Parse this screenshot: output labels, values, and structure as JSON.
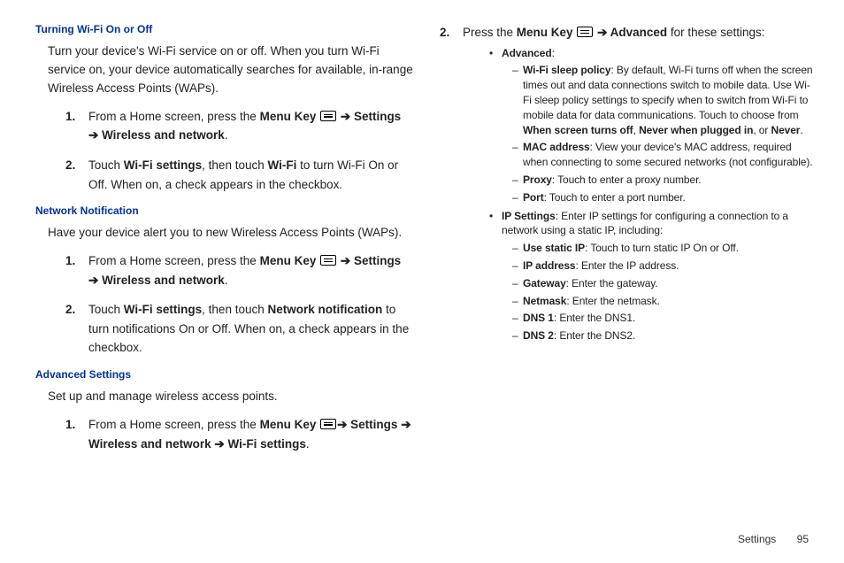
{
  "left": {
    "section1": {
      "heading": "Turning Wi-Fi On or Off",
      "intro": "Turn your device's Wi-Fi service on or off. When you turn Wi-Fi service on, your device automatically searches for available, in-range Wireless Access Points (WAPs).",
      "step1_a": "From a Home screen, press the ",
      "step1_menukey": "Menu Key",
      "step1_b": " ",
      "step1_arrow1": " ➔ ",
      "step1_settings": "Settings",
      "step1_arrow2": " ➔ ",
      "step1_wireless": "Wireless and network",
      "step1_end": ".",
      "step2_a": "Touch ",
      "step2_wifisettings": "Wi-Fi settings",
      "step2_b": ", then touch ",
      "step2_wifi": "Wi-Fi",
      "step2_c": " to turn Wi-Fi On or Off. When on, a check appears in the checkbox."
    },
    "section2": {
      "heading": "Network Notification",
      "intro": "Have your device alert you to new Wireless Access Points (WAPs).",
      "step1_a": "From a Home screen, press the ",
      "step1_menukey": "Menu Key",
      "step1_arrow1": " ➔ ",
      "step1_settings": "Settings",
      "step1_arrow2": " ➔ ",
      "step1_wireless": "Wireless and network",
      "step1_end": ".",
      "step2_a": "Touch ",
      "step2_wifisettings": "Wi-Fi settings",
      "step2_b": ", then touch ",
      "step2_netnotif": "Network notification",
      "step2_c": " to turn notifications On or Off. When on, a check appears in the checkbox."
    },
    "section3": {
      "heading": "Advanced Settings",
      "intro": "Set up and manage wireless access points.",
      "step1_a": "From a Home screen, press the ",
      "step1_menukey": "Menu Key",
      "step1_arrow1": "➔ ",
      "step1_settings": "Settings",
      "step1_arrow2": " ➔ ",
      "step1_wireless": "Wireless and network",
      "step1_arrow3": " ➔ ",
      "step1_wifisettings": "Wi-Fi settings",
      "step1_end": "."
    }
  },
  "right": {
    "step2_a": "Press the ",
    "step2_menukey": "Menu Key",
    "step2_arrow": " ➔ ",
    "step2_advanced": "Advanced",
    "step2_b": " for these settings:",
    "bullet_advanced": "Advanced",
    "bullet_advanced_colon": ":",
    "sleep_label": "Wi-Fi sleep policy",
    "sleep_a": ": By default, Wi-Fi turns off when the screen times out and data connections switch to mobile data. Use Wi-Fi sleep policy settings to specify when to switch from Wi-Fi to mobile data for data communications. Touch to choose from ",
    "sleep_opt1": "When screen turns off",
    "sleep_sep1": ", ",
    "sleep_opt2": "Never when plugged in",
    "sleep_sep2": ", or ",
    "sleep_opt3": "Never",
    "sleep_end": ".",
    "mac_label": "MAC address",
    "mac_text": ": View your device's MAC address, required when connecting to some secured networks (not configurable).",
    "proxy_label": "Proxy",
    "proxy_text": ": Touch to enter a proxy number.",
    "port_label": "Port",
    "port_text": ": Touch to enter a port number.",
    "ip_label": "IP Settings",
    "ip_text": ": Enter IP settings for configuring a connection to a network using a static IP, including:",
    "static_label": "Use static IP",
    "static_text": ": Touch to turn static IP On or Off.",
    "ipaddr_label": "IP address",
    "ipaddr_text": ": Enter the IP address.",
    "gateway_label": "Gateway",
    "gateway_text": ": Enter the gateway.",
    "netmask_label": "Netmask",
    "netmask_text": ": Enter the netmask.",
    "dns1_label": "DNS 1",
    "dns1_text": ": Enter the DNS1.",
    "dns2_label": "DNS 2",
    "dns2_text": ": Enter the DNS2."
  },
  "footer": {
    "section": "Settings",
    "page": "95"
  },
  "nums": {
    "n1": "1.",
    "n2": "2."
  }
}
